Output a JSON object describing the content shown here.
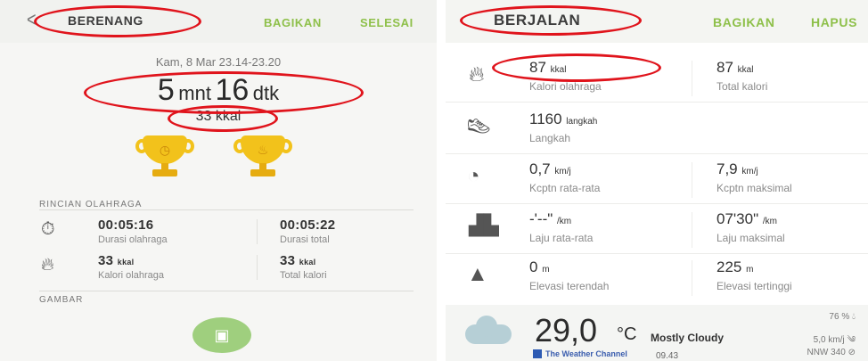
{
  "left": {
    "header": {
      "back_icon": "back-arrow-icon",
      "title": "BERENANG",
      "share": "BAGIKAN",
      "done": "SELESAI"
    },
    "date": "Kam, 8 Mar 23.14-23.20",
    "duration": {
      "minutes": "5",
      "min_unit": "mnt",
      "seconds": "16",
      "sec_unit": "dtk"
    },
    "calories": "33 kkal",
    "trophies": [
      {
        "icon": "stopwatch-trophy-icon"
      },
      {
        "icon": "fire-trophy-icon"
      }
    ],
    "details_title": "RINCIAN OLAHRAGA",
    "stats": [
      {
        "icon": "stopwatch-icon",
        "value": "00:05:16",
        "label": "Durasi olahraga"
      },
      {
        "value": "00:05:22",
        "label": "Durasi total"
      },
      {
        "icon": "flame-icon",
        "value": "33",
        "unit": "kkal",
        "label": "Kalori olahraga"
      },
      {
        "value": "33",
        "unit": "kkal",
        "label": "Total kalori"
      }
    ],
    "images_title": "GAMBAR",
    "image_button_icon": "gallery-icon"
  },
  "right": {
    "header": {
      "title": "BERJALAN",
      "share": "BAGIKAN",
      "delete": "HAPUS"
    },
    "rows": [
      {
        "icon": "flame-icon",
        "a": {
          "value": "87",
          "unit": "kkal",
          "label": "Kalori olahraga"
        },
        "b": {
          "value": "87",
          "unit": "kkal",
          "label": "Total kalori"
        }
      },
      {
        "icon": "shoe-icon",
        "a": {
          "value": "1160",
          "unit": "langkah",
          "label": "Langkah"
        }
      },
      {
        "icon": "speedometer-icon",
        "a": {
          "value": "0,7",
          "unit": "km/j",
          "label": "Kcptn rata-rata"
        },
        "b": {
          "value": "7,9",
          "unit": "km/j",
          "label": "Kcptn maksimal"
        }
      },
      {
        "icon": "road-icon",
        "a": {
          "value": "-'--\"",
          "unit": "/km",
          "label": "Laju rata-rata"
        },
        "b": {
          "value": "07'30\"",
          "unit": "/km",
          "label": "Laju maksimal"
        }
      },
      {
        "icon": "mountain-icon",
        "a": {
          "value": "0",
          "unit": "m",
          "label": "Elevasi terendah"
        },
        "b": {
          "value": "225",
          "unit": "m",
          "label": "Elevasi tertinggi"
        }
      }
    ],
    "weather": {
      "icon": "cloud-icon",
      "temperature": "29,0",
      "temp_unit": "°C",
      "condition": "Mostly Cloudy",
      "provider": "The Weather Channel",
      "time": "09.43",
      "humidity": "76 %",
      "wind_speed": "5,0 km/j",
      "wind_dir": "NNW 340"
    }
  },
  "colors": {
    "accent": "#8ec04a",
    "annotation": "#e0141c",
    "trophy": "#f2c21b"
  }
}
